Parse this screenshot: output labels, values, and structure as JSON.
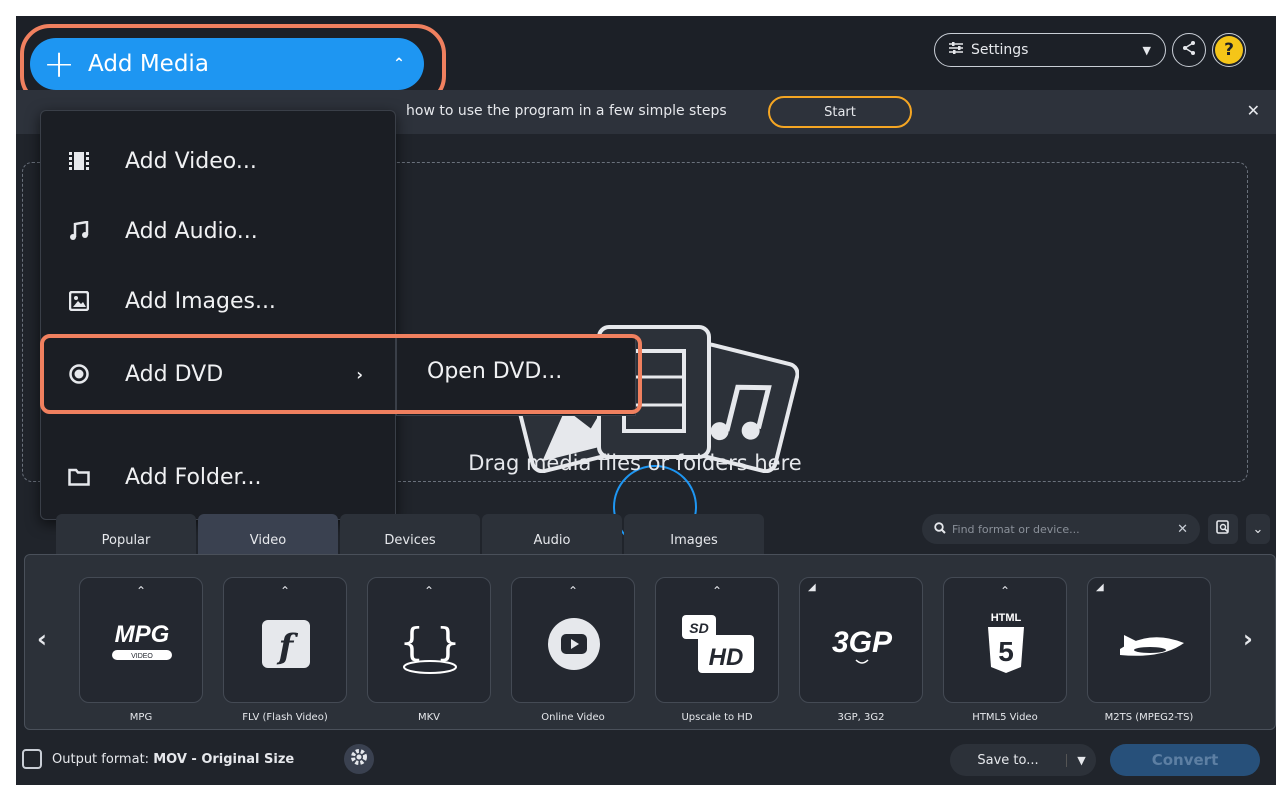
{
  "header": {
    "add_media_label": "Add Media",
    "settings_label": "Settings",
    "help_label": "?"
  },
  "banner": {
    "text": "how to use the program in a few simple steps",
    "start_label": "Start"
  },
  "dropzone": {
    "text": "Drag media files or folders here"
  },
  "add_media_menu": {
    "items": [
      {
        "label": "Add Video...",
        "icon": "film-icon"
      },
      {
        "label": "Add Audio...",
        "icon": "music-icon"
      },
      {
        "label": "Add Images...",
        "icon": "image-icon"
      },
      {
        "label": "Add DVD",
        "icon": "disc-icon"
      },
      {
        "label": "Add Folder...",
        "icon": "folder-icon"
      }
    ],
    "dvd_submenu": {
      "items": [
        {
          "label": "Open DVD..."
        }
      ]
    }
  },
  "format_tabs": {
    "tabs": [
      "Popular",
      "Video",
      "Devices",
      "Audio",
      "Images"
    ],
    "active": "Video",
    "search_placeholder": "Find format or device..."
  },
  "formats": {
    "cards": [
      {
        "label": "MPG",
        "icon_text": "MPG",
        "sub_text": "VIDEO"
      },
      {
        "label": "FLV (Flash Video)",
        "icon_text": "f"
      },
      {
        "label": "MKV",
        "icon_text": "{ }"
      },
      {
        "label": "Online Video"
      },
      {
        "label": "Upscale to HD",
        "icon_text": "HD",
        "sub_text": "SD"
      },
      {
        "label": "3GP, 3G2",
        "icon_text": "3GP"
      },
      {
        "label": "HTML5 Video",
        "icon_text": "HTML",
        "sub_text": "5"
      },
      {
        "label": "M2TS (MPEG2-TS)"
      }
    ]
  },
  "bottom": {
    "output_prefix": "Output format:",
    "output_value": "MOV - Original Size",
    "save_to_label": "Save to...",
    "convert_label": "Convert"
  },
  "colors": {
    "accent": "#1e96f2",
    "highlight": "#f0805f",
    "start_border": "#f5a623",
    "help": "#f5c518",
    "background": "#20242b"
  }
}
